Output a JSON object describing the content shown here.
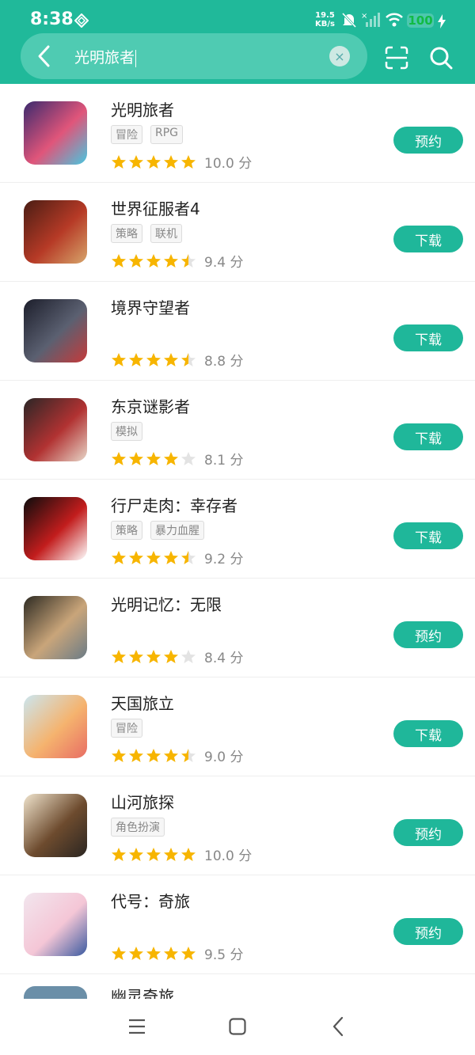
{
  "status_bar": {
    "time": "8:38",
    "speed_value": "19.5",
    "speed_unit": "KB/s",
    "battery": "100"
  },
  "search": {
    "query": "光明旅者",
    "clear_symbol": "×"
  },
  "apps": [
    {
      "name": "光明旅者",
      "tags": [
        "冒险",
        "RPG"
      ],
      "rating": 5,
      "score": "10.0 分",
      "action": "预约",
      "icon_colors": [
        "#3b2a6e",
        "#e0557a",
        "#47c7e0"
      ]
    },
    {
      "name": "世界征服者4",
      "tags": [
        "策略",
        "联机"
      ],
      "rating": 4.5,
      "score": "9.4 分",
      "action": "下载",
      "icon_colors": [
        "#4a1d14",
        "#b63a26",
        "#d7a56b"
      ]
    },
    {
      "name": "境界守望者",
      "tags": [],
      "rating": 4.5,
      "score": "8.8 分",
      "action": "下载",
      "icon_colors": [
        "#1c1e2b",
        "#5b6071",
        "#c63a3a"
      ]
    },
    {
      "name": "东京谜影者",
      "tags": [
        "模拟"
      ],
      "rating": 4,
      "score": "8.1 分",
      "action": "下载",
      "icon_colors": [
        "#2b2626",
        "#b13232",
        "#e8d6c8"
      ]
    },
    {
      "name": "行尸走肉：幸存者",
      "tags": [
        "策略",
        "暴力血腥"
      ],
      "rating": 4.5,
      "score": "9.2 分",
      "action": "下载",
      "icon_colors": [
        "#0c0c0c",
        "#c21d1d",
        "#ffffff"
      ]
    },
    {
      "name": "光明记忆：无限",
      "tags": [],
      "rating": 4,
      "score": "8.4 分",
      "action": "预约",
      "icon_colors": [
        "#2d2a22",
        "#c9a57a",
        "#6a7b86"
      ]
    },
    {
      "name": "天国旅立",
      "tags": [
        "冒险"
      ],
      "rating": 4.5,
      "score": "9.0 分",
      "action": "下载",
      "icon_colors": [
        "#cbe6ef",
        "#f5b36e",
        "#e86d64"
      ]
    },
    {
      "name": "山河旅探",
      "tags": [
        "角色扮演"
      ],
      "rating": 5,
      "score": "10.0 分",
      "action": "预约",
      "icon_colors": [
        "#efe3cc",
        "#6d4b2e",
        "#2b2622"
      ]
    },
    {
      "name": "代号：奇旅",
      "tags": [],
      "rating": 5,
      "score": "9.5 分",
      "action": "预约",
      "icon_colors": [
        "#f2e6ee",
        "#f4c6d6",
        "#3b5aa0"
      ]
    }
  ],
  "partial_app": {
    "name": "幽灵奇旅"
  },
  "colors": {
    "accent": "#20b99a",
    "star": "#f7b500",
    "star_empty": "#e3e3e3"
  }
}
